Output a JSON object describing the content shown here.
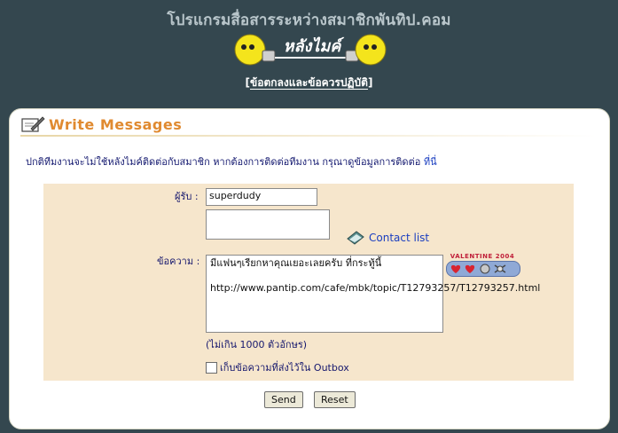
{
  "header": {
    "site_title": "โปรแกรมสื่อสารระหว่างสมาชิกพันทิป.คอม",
    "logo_text": "หลังไมค์",
    "rules_link": "ข้อตกลงและข้อควรปฏิบัติ",
    "bracket_open": "[",
    "bracket_close": "]"
  },
  "panel": {
    "title": "Write  Messages",
    "notice": "ปกติทีมงานจะไม่ใช้หลังไมค์ติดต่อกับสมาชิก หากต้องการติดต่อทีมงาน กรุณาดูข้อมูลการติดต่อ ",
    "notice_link": "ที่นี่"
  },
  "form": {
    "recipient_label": "ผู้รับ :",
    "recipient_value": "superdudy",
    "contact_list": "Contact list",
    "message_label": "ข้อความ :",
    "message_value": "มีแฟนๆเรียกหาคุณเยอะเลยครับ ที่กระทู้นี้\n\nhttp://www.pantip.com/cafe/mbk/topic/T12793257/T12793257.html",
    "limit_note": "(ไม่เกิน 1000 ตัวอักษร)",
    "save_outbox": "เก็บข้อความที่ส่งไว้ใน Outbox",
    "valentine_text": "VALENTINE 2004"
  },
  "buttons": {
    "send": "Send",
    "reset": "Reset"
  }
}
